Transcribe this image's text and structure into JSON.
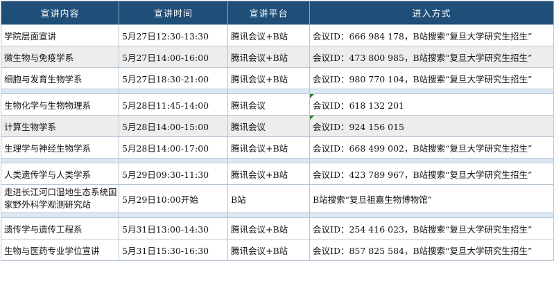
{
  "headers": {
    "content": "宣讲内容",
    "time": "宣讲时间",
    "platform": "宣讲平台",
    "access": "进入方式"
  },
  "rows": [
    {
      "content": "学院层面宣讲",
      "time": "5月27日12:30-13:30",
      "platform": "腾讯会议+B站",
      "access": "会议ID：666 984 178，B站搜索“复旦大学研究生招生”"
    },
    {
      "content": "微生物与免疫学系",
      "time": "5月27日14:00-16:00",
      "platform": "腾讯会议+B站",
      "access": "会议ID：473 800 985，B站搜索“复旦大学研究生招生”"
    },
    {
      "content": "细胞与发育生物学系",
      "time": "5月27日18:30-21:00",
      "platform": "腾讯会议+B站",
      "access": "会议ID：980 770 104，B站搜索“复旦大学研究生招生”"
    },
    {
      "content": "生物化学与生物物理系",
      "time": "5月28日11:45-14:00",
      "platform": "腾讯会议",
      "access": "会议ID：618 132 201"
    },
    {
      "content": "计算生物学系",
      "time": "5月28日14:00-15:00",
      "platform": "腾讯会议",
      "access": "会议ID：924 156 015"
    },
    {
      "content": "生理学与神经生物学系",
      "time": "5月28日14:00-17:00",
      "platform": "腾讯会议+B站",
      "access": "会议ID：668 499 002，B站搜索“复旦大学研究生招生”"
    },
    {
      "content": "人类遗传学与人类学系",
      "time": "5月29日09:30-11:30",
      "platform": "腾讯会议+B站",
      "access": "会议ID：423 789 967，B站搜索“复旦大学研究生招生”"
    },
    {
      "content": "走进长江河口湿地生态系统国家野外科学观测研究站",
      "time": "5月29日10:00开始",
      "platform": "B站",
      "access": "B站搜索“复旦祖嘉生物博物馆”"
    },
    {
      "content": "遗传学与遗传工程系",
      "time": "5月31日13:00-14:30",
      "platform": "腾讯会议+B站",
      "access": "会议ID：254 416 023，B站搜索“复旦大学研究生招生”"
    },
    {
      "content": "生物与医药专业学位宣讲",
      "time": "5月31日15:30-16:30",
      "platform": "腾讯会议+B站",
      "access": "会议ID：857 825 584，B站搜索“复旦大学研究生招生”"
    }
  ],
  "colors": {
    "header_bg": "#1f4e79",
    "separator": "#dce8f3",
    "shaded_row": "#ededed",
    "note_marker": "#2e7d32"
  }
}
